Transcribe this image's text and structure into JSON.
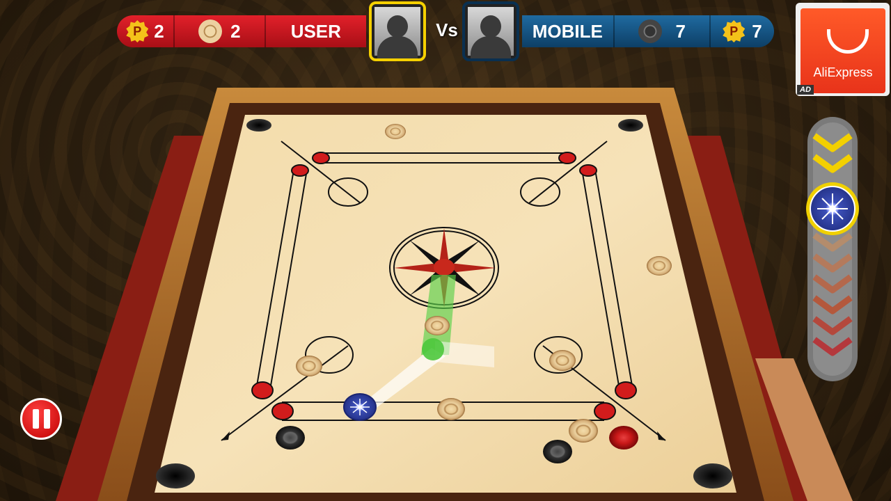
{
  "scoreboard": {
    "user": {
      "label": "USER",
      "points": "2",
      "coins": "2"
    },
    "vs": "Vs",
    "mobile": {
      "label": "MOBILE",
      "points": "7",
      "coins": "7"
    },
    "points_badge": "P"
  },
  "ad": {
    "brand": "AliExpress",
    "tag": "AD"
  },
  "colors": {
    "user": "#d0161f",
    "mobile": "#16507e",
    "board": "#f2d9a8",
    "queen": "#d21c1c"
  },
  "icons": {
    "pause": "pause-icon",
    "striker": "striker-icon",
    "power": "chevron-up-icon"
  }
}
